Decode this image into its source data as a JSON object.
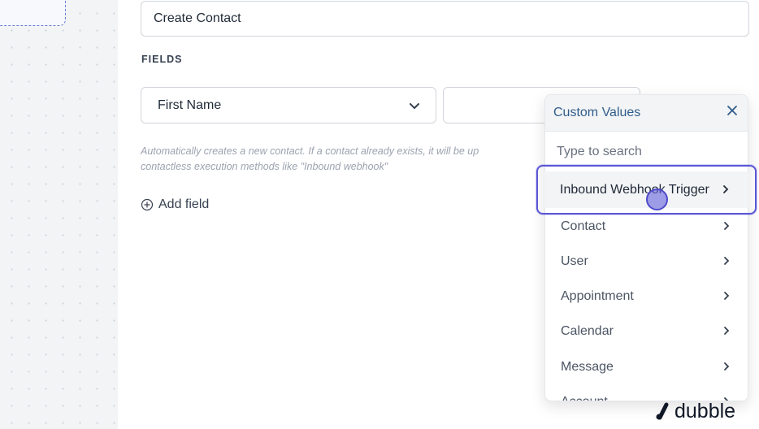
{
  "form": {
    "action_name": "Create Contact",
    "fields_heading": "FIELDS",
    "field_select_value": "First Name",
    "help_text_line1": "Automatically creates a new contact. If a contact already exists, it will be up",
    "help_text_line2": "contactless execution methods like \"Inbound webhook\"",
    "add_field_label": "Add field"
  },
  "dropdown": {
    "title": "Custom Values",
    "search_placeholder": "Type to search",
    "items": [
      {
        "label": "Inbound Webhook Trigger"
      },
      {
        "label": "Contact"
      },
      {
        "label": "User"
      },
      {
        "label": "Appointment"
      },
      {
        "label": "Calendar"
      },
      {
        "label": "Message"
      },
      {
        "label": "Account"
      }
    ]
  },
  "brand": {
    "name": "dubble"
  },
  "colors": {
    "accent": "#5b57d6",
    "dropdown_title": "#2f5d8a",
    "canvas_bg": "#f3f4f6"
  },
  "icons": {
    "chevron": "chevron-down-icon",
    "close": "close-icon",
    "add": "plus-circle-icon",
    "arrow": "chevron-right-icon"
  }
}
